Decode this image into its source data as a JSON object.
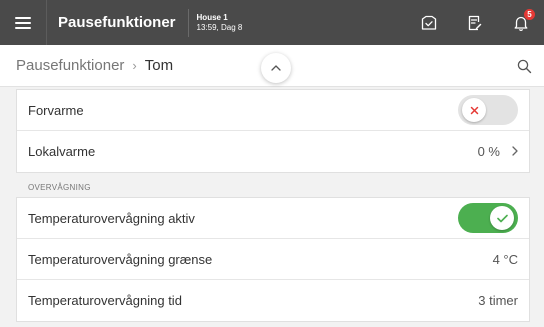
{
  "topbar": {
    "title": "Pausefunktioner",
    "house": "House 1",
    "time": "13:59, Dag 8",
    "notification_count": "5",
    "icons": [
      "menu-icon",
      "checklist-icon",
      "document-edit-icon",
      "bell-icon"
    ]
  },
  "breadcrumb": {
    "parent": "Pausefunktioner",
    "separator": "›",
    "current": "Tom"
  },
  "heating": {
    "forvarme_label": "Forvarme",
    "forvarme_on": false,
    "lokalvarme_label": "Lokalvarme",
    "lokalvarme_value": "0 %"
  },
  "monitoring": {
    "section_title": "OVERVÅGNING",
    "active_label": "Temperaturovervågning aktiv",
    "active_on": true,
    "limit_label": "Temperaturovervågning grænse",
    "limit_value": "4 °C",
    "time_label": "Temperaturovervågning tid",
    "time_value": "3 timer"
  },
  "colors": {
    "topbar": "#4a4a4a",
    "toggle_on": "#4caf50",
    "toggle_off_x": "#e53935",
    "badge": "#e53935"
  }
}
